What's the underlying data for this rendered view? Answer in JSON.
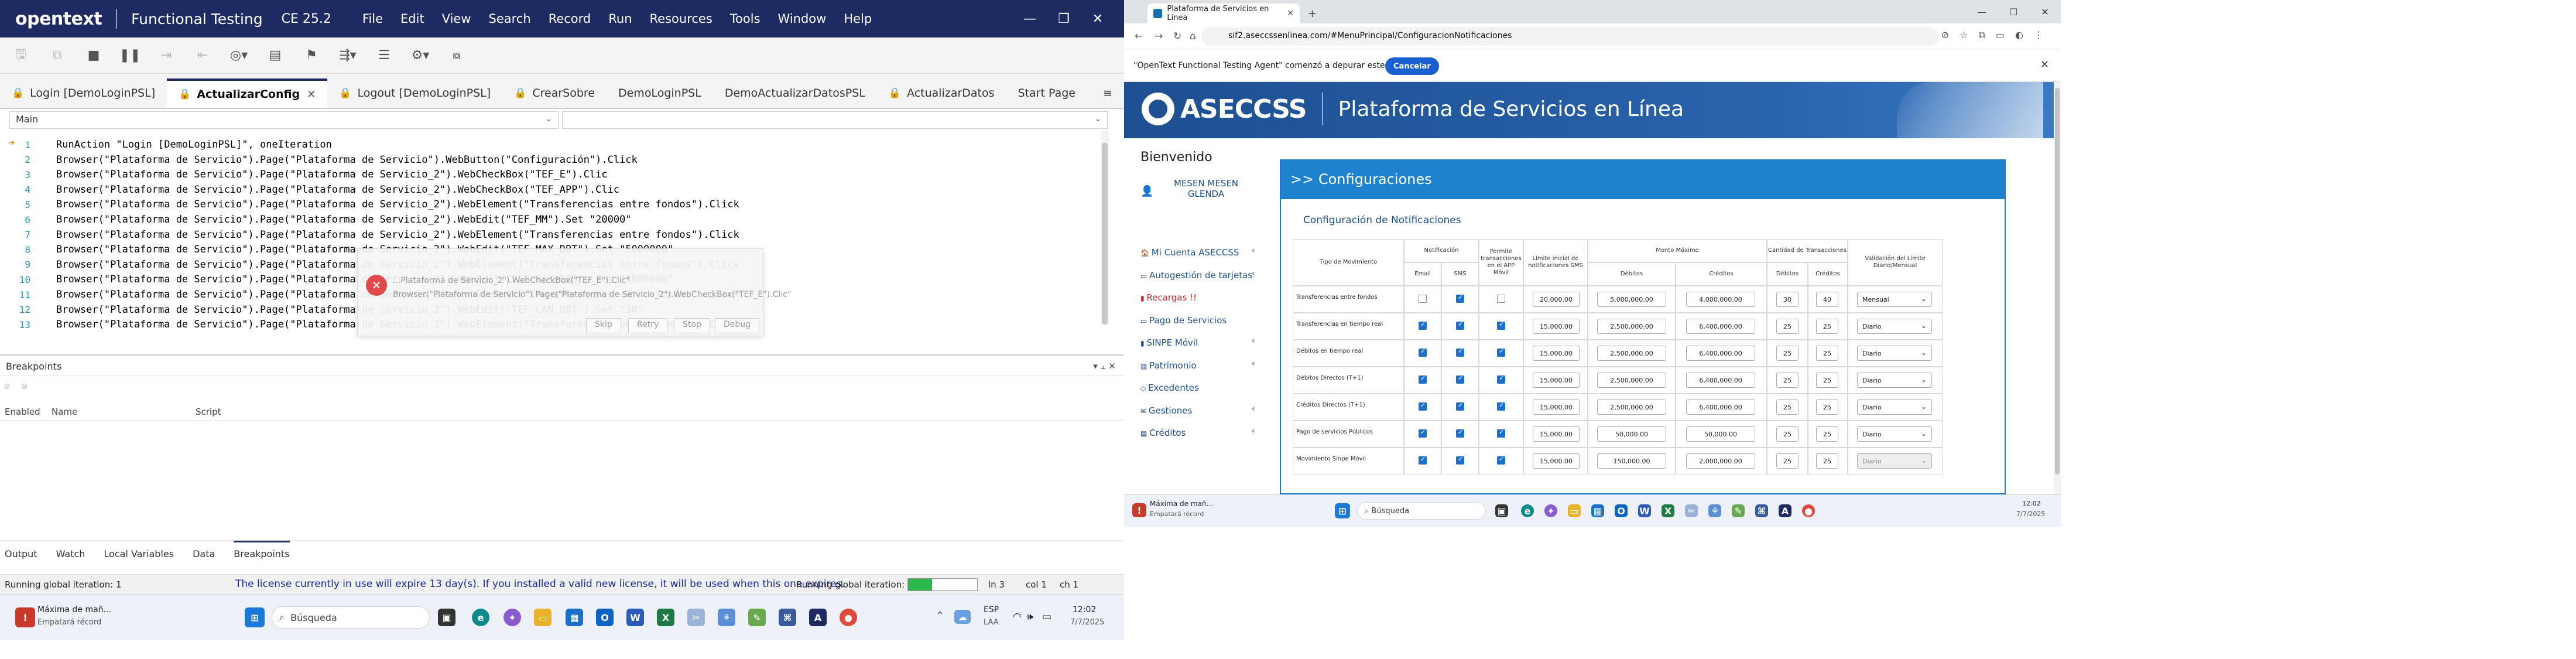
{
  "oft": {
    "brand": "opentext",
    "app_name": "Functional Testing",
    "version": "CE 25.2",
    "menu": [
      "File",
      "Edit",
      "View",
      "Search",
      "Record",
      "Run",
      "Resources",
      "Tools",
      "Window",
      "Help"
    ],
    "tabs": [
      {
        "label": "Login [DemoLoginPSL]",
        "locked": true,
        "closable": false
      },
      {
        "label": "ActualizarConfig",
        "locked": true,
        "closable": true,
        "active": true
      },
      {
        "label": "Logout [DemoLoginPSL]",
        "locked": true,
        "closable": false
      },
      {
        "label": "CrearSobre",
        "locked": true,
        "closable": false
      },
      {
        "label": "DemoLoginPSL",
        "locked": false,
        "closable": false
      },
      {
        "label": "DemoActualizarDatosPSL",
        "locked": false,
        "closable": false
      },
      {
        "label": "ActualizarDatos",
        "locked": true,
        "closable": false
      },
      {
        "label": "Start Page",
        "locked": false,
        "closable": false
      }
    ],
    "action_combo": "Main",
    "code_lines": [
      {
        "n": "1",
        "text": "RunAction \"Login [DemoLoginPSL]\", oneIteration"
      },
      {
        "n": "2",
        "text": "Browser(\"Plataforma de Servicio\").Page(\"Plataforma de Servicio\").WebButton(\"Configuración\").Click"
      },
      {
        "n": "3",
        "text": "Browser(\"Plataforma de Servicio\").Page(\"Plataforma de Servicio_2\").WebCheckBox(\"TEF_E\").Clic"
      },
      {
        "n": "4",
        "text": "Browser(\"Plataforma de Servicio\").Page(\"Plataforma de Servicio_2\").WebCheckBox(\"TEF_APP\").Clic"
      },
      {
        "n": "5",
        "text": "Browser(\"Plataforma de Servicio\").Page(\"Plataforma de Servicio_2\").WebElement(\"Transferencias entre fondos\").Click"
      },
      {
        "n": "6",
        "text": "Browser(\"Plataforma de Servicio\").Page(\"Plataforma de Servicio_2\").WebEdit(\"TEF_MM\").Set \"20000\""
      },
      {
        "n": "7",
        "text": "Browser(\"Plataforma de Servicio\").Page(\"Plataforma de Servicio_2\").WebElement(\"Transferencias entre fondos\").Click"
      },
      {
        "n": "8",
        "text": "Browser(\"Plataforma de Servicio\").Page(\"Plataforma de Servicio_2\").WebEdit(\"TEF_MAX_DBT\").Set \"5000000\""
      },
      {
        "n": "9",
        "text": "Browser(\"Plataforma de Servicio\").Page(\"Plataforma de Servicio_2\").WebElement(\"Transferencias entre fondos\").Click"
      },
      {
        "n": "10",
        "text": "Browser(\"Plataforma de Servicio\").Page(\"Plataforma de Servicio_2\").WebEdit(\"TEF_MAX_CRD\").Set \"4000000\""
      },
      {
        "n": "11",
        "text": "Browser(\"Plataforma de Servicio\").Page(\"Plataforma de Servicio_2\").WebElement(\"Transferencias entre fondos\").Click"
      },
      {
        "n": "12",
        "text": "Browser(\"Plataforma de Servicio\").Page(\"Plataforma de Servicio_2\").WebEdit(\"TEF_CAN_DBT\").Set \"30\""
      },
      {
        "n": "13",
        "text": "Browser(\"Plataforma de Servicio\").Page(\"Plataforma de Servicio_2\").WebElement(\"Transferencias entre fondos\").Click"
      }
    ],
    "toast": {
      "line1": "...Plataforma de Servicio_2\").WebCheckBox(\"TEF_E\").Clic\"",
      "line2": "Browser(\"Plataforma de Servicio\").Page(\"Plataforma de Servicio_2\").WebCheckBox(\"TEF_E\").Clic\"",
      "buttons": [
        "Skip",
        "Retry",
        "Stop",
        "Debug"
      ]
    },
    "breakpoints": {
      "title": "Breakpoints",
      "columns": [
        "Enabled",
        "Name",
        "Script"
      ]
    },
    "bottom_tabs": [
      "Output",
      "Watch",
      "Local Variables",
      "Data",
      "Breakpoints"
    ],
    "active_bottom_tab": "Breakpoints",
    "status": {
      "iteration": "Running global iteration: 1",
      "license": "The license currently in use will expire 13 day(s). If you installed a valid new license, it will be used when this one expires.",
      "iteration2": "Running global iteration: 1",
      "progress": 0.35,
      "ln": "ln 3",
      "col": "col 1",
      "ch": "ch 1"
    }
  },
  "taskbar_main": {
    "notify_title": "Máxima de mañ...",
    "notify_sub": "Empatará récord",
    "search_placeholder": "Búsqueda",
    "lang": "ESP",
    "lang_sub": "LAA",
    "time": "12:02",
    "date": "7/7/2025"
  },
  "browser": {
    "tab_title": "Plataforma de Servicios en Línea",
    "url": "sif2.aseccssenlinea.com/#MenuPrincipal/ConfiguracionNotificaciones",
    "infobar_text": "\"OpenText Functional Testing Agent\" comenzó a depurar este navegador",
    "cancel_label": "Cancelar"
  },
  "portal": {
    "brand": "ASECCSS",
    "title": "Plataforma de Servicios en Línea",
    "welcome": "Bienvenido",
    "user": "MESEN MESEN GLENDA",
    "nav": [
      {
        "label": "Mi Cuenta ASECCSS",
        "chevron": true,
        "red": false
      },
      {
        "label": "Autogestión de tarjetas",
        "chevron": true,
        "red": false
      },
      {
        "label": "Recargas !!",
        "chevron": false,
        "red": true
      },
      {
        "label": "Pago de Servicios",
        "chevron": false,
        "red": false
      },
      {
        "label": "SINPE Móvil",
        "chevron": true,
        "red": false
      },
      {
        "label": "Patrimonio",
        "chevron": true,
        "red": false
      },
      {
        "label": "Excedentes",
        "chevron": false,
        "red": false
      },
      {
        "label": "Gestiones",
        "chevron": true,
        "red": false
      },
      {
        "label": "Créditos",
        "chevron": true,
        "red": false
      }
    ],
    "panel_title": ">> Configuraciones",
    "panel_subtitle": "Configuración de Notificaciones",
    "headers": {
      "tipo": "Tipo de Movimiento",
      "notificacion": "Notificación",
      "email": "Email",
      "sms": "SMS",
      "permite": "Permite transacciones en el APP Móvil",
      "limite_sms": "Límite inicial de notificaciones SMS",
      "monto": "Monto Máximo",
      "debitos": "Débitos",
      "creditos": "Créditos",
      "cantidad": "Cantidad de Transacciones",
      "cant_debitos": "Débitos",
      "cant_creditos": "Créditos",
      "validacion": "Validación del Límite Diario/Mensual"
    },
    "rows": [
      {
        "label": "Transferencias entre fondos",
        "email": false,
        "sms": true,
        "app": false,
        "limite": "20,000.00",
        "deb": "5,000,000.00",
        "cred": "4,000,000.00",
        "cdeb": "30",
        "ccred": "40",
        "val": "Mensual",
        "val_disabled": false
      },
      {
        "label": "Transferencias en tiempo real",
        "email": true,
        "sms": true,
        "app": true,
        "limite": "15,000.00",
        "deb": "2,500,000.00",
        "cred": "6,400,000.00",
        "cdeb": "25",
        "ccred": "25",
        "val": "Diario",
        "val_disabled": false
      },
      {
        "label": "Débitos en tiempo real",
        "email": true,
        "sms": true,
        "app": true,
        "limite": "15,000.00",
        "deb": "2,500,000.00",
        "cred": "6,400,000.00",
        "cdeb": "25",
        "ccred": "25",
        "val": "Diario",
        "val_disabled": false
      },
      {
        "label": "Débitos Directos (T+1)",
        "email": true,
        "sms": true,
        "app": true,
        "limite": "15,000.00",
        "deb": "2,500,000.00",
        "cred": "6,400,000.00",
        "cdeb": "25",
        "ccred": "25",
        "val": "Diario",
        "val_disabled": false
      },
      {
        "label": "Créditos Directos (T+1)",
        "email": true,
        "sms": true,
        "app": true,
        "limite": "15,000.00",
        "deb": "2,500,000.00",
        "cred": "6,400,000.00",
        "cdeb": "25",
        "ccred": "25",
        "val": "Diario",
        "val_disabled": false
      },
      {
        "label": "Pago de servicios Públicos",
        "email": true,
        "sms": true,
        "app": true,
        "limite": "15,000.00",
        "deb": "50,000.00",
        "cred": "50,000.00",
        "cdeb": "25",
        "ccred": "25",
        "val": "Diario",
        "val_disabled": false
      },
      {
        "label": "Movimiento Sinpe Móvil",
        "email": true,
        "sms": true,
        "app": true,
        "limite": "15,000.00",
        "deb": "150,000.00",
        "cred": "2,000,000.00",
        "cdeb": "25",
        "ccred": "25",
        "val": "Diario",
        "val_disabled": true
      }
    ]
  },
  "taskbar_browser": {
    "notify_title": "Máxima de mañ...",
    "notify_sub": "Empatará récord",
    "search_placeholder": "Búsqueda",
    "time": "12:02",
    "date": "7/7/2025"
  },
  "colors": {
    "oft_title_bg": "#1e2a62",
    "license_text": "#1a2a9e",
    "banner": "#1d4f91",
    "panel_head": "#1e82cf",
    "progress": "#2db84d",
    "error": "#e14a4a"
  }
}
